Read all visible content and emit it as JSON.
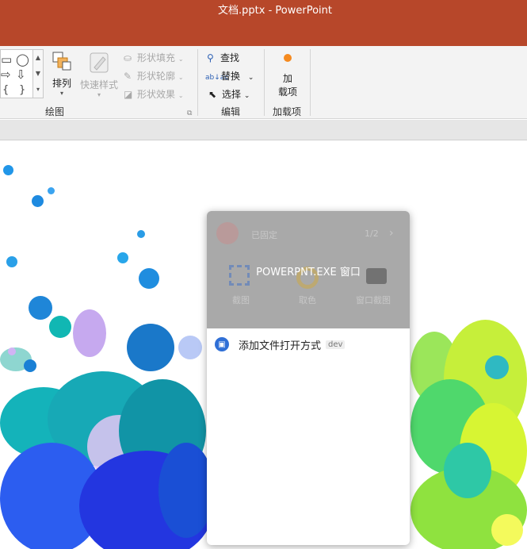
{
  "window": {
    "title": "文档.pptx  -  PowerPoint"
  },
  "ribbon": {
    "drawing": {
      "label": "绘图",
      "arrange": "排列",
      "quick_styles": "快速样式",
      "shape_fill": "形状填充",
      "shape_outline": "形状轮廓",
      "shape_effects": "形状效果"
    },
    "editing": {
      "label": "编辑",
      "find": "查找",
      "replace": "替换",
      "select": "选择"
    },
    "addins": {
      "label": "加载项",
      "button_line1": "加",
      "button_line2": "载项"
    }
  },
  "popup": {
    "window_title": "POWERPNT.EXE 窗口",
    "blurred": {
      "app_name": "已固定",
      "pager": "1/2",
      "actions": [
        "截图",
        "取色",
        "窗口截图"
      ]
    },
    "item_label": "添加文件打开方式",
    "item_tag": "dev"
  },
  "colors": {
    "title_bar": "#b7472a",
    "addin_dot": "#f58a1f",
    "folder_icon": "#2f6fd6"
  }
}
